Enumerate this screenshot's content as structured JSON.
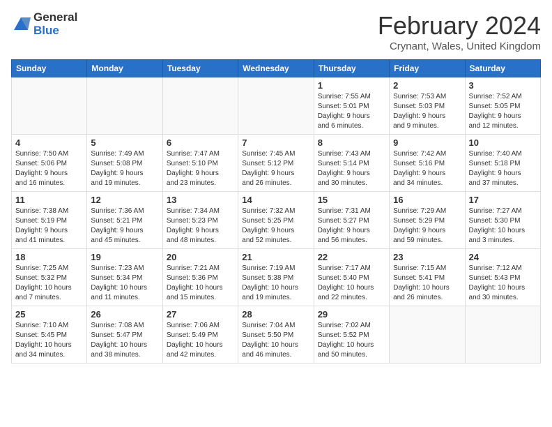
{
  "header": {
    "logo_general": "General",
    "logo_blue": "Blue",
    "month_title": "February 2024",
    "location": "Crynant, Wales, United Kingdom"
  },
  "weekdays": [
    "Sunday",
    "Monday",
    "Tuesday",
    "Wednesday",
    "Thursday",
    "Friday",
    "Saturday"
  ],
  "weeks": [
    [
      {
        "day": "",
        "info": ""
      },
      {
        "day": "",
        "info": ""
      },
      {
        "day": "",
        "info": ""
      },
      {
        "day": "",
        "info": ""
      },
      {
        "day": "1",
        "info": "Sunrise: 7:55 AM\nSunset: 5:01 PM\nDaylight: 9 hours\nand 6 minutes."
      },
      {
        "day": "2",
        "info": "Sunrise: 7:53 AM\nSunset: 5:03 PM\nDaylight: 9 hours\nand 9 minutes."
      },
      {
        "day": "3",
        "info": "Sunrise: 7:52 AM\nSunset: 5:05 PM\nDaylight: 9 hours\nand 12 minutes."
      }
    ],
    [
      {
        "day": "4",
        "info": "Sunrise: 7:50 AM\nSunset: 5:06 PM\nDaylight: 9 hours\nand 16 minutes."
      },
      {
        "day": "5",
        "info": "Sunrise: 7:49 AM\nSunset: 5:08 PM\nDaylight: 9 hours\nand 19 minutes."
      },
      {
        "day": "6",
        "info": "Sunrise: 7:47 AM\nSunset: 5:10 PM\nDaylight: 9 hours\nand 23 minutes."
      },
      {
        "day": "7",
        "info": "Sunrise: 7:45 AM\nSunset: 5:12 PM\nDaylight: 9 hours\nand 26 minutes."
      },
      {
        "day": "8",
        "info": "Sunrise: 7:43 AM\nSunset: 5:14 PM\nDaylight: 9 hours\nand 30 minutes."
      },
      {
        "day": "9",
        "info": "Sunrise: 7:42 AM\nSunset: 5:16 PM\nDaylight: 9 hours\nand 34 minutes."
      },
      {
        "day": "10",
        "info": "Sunrise: 7:40 AM\nSunset: 5:18 PM\nDaylight: 9 hours\nand 37 minutes."
      }
    ],
    [
      {
        "day": "11",
        "info": "Sunrise: 7:38 AM\nSunset: 5:19 PM\nDaylight: 9 hours\nand 41 minutes."
      },
      {
        "day": "12",
        "info": "Sunrise: 7:36 AM\nSunset: 5:21 PM\nDaylight: 9 hours\nand 45 minutes."
      },
      {
        "day": "13",
        "info": "Sunrise: 7:34 AM\nSunset: 5:23 PM\nDaylight: 9 hours\nand 48 minutes."
      },
      {
        "day": "14",
        "info": "Sunrise: 7:32 AM\nSunset: 5:25 PM\nDaylight: 9 hours\nand 52 minutes."
      },
      {
        "day": "15",
        "info": "Sunrise: 7:31 AM\nSunset: 5:27 PM\nDaylight: 9 hours\nand 56 minutes."
      },
      {
        "day": "16",
        "info": "Sunrise: 7:29 AM\nSunset: 5:29 PM\nDaylight: 9 hours\nand 59 minutes."
      },
      {
        "day": "17",
        "info": "Sunrise: 7:27 AM\nSunset: 5:30 PM\nDaylight: 10 hours\nand 3 minutes."
      }
    ],
    [
      {
        "day": "18",
        "info": "Sunrise: 7:25 AM\nSunset: 5:32 PM\nDaylight: 10 hours\nand 7 minutes."
      },
      {
        "day": "19",
        "info": "Sunrise: 7:23 AM\nSunset: 5:34 PM\nDaylight: 10 hours\nand 11 minutes."
      },
      {
        "day": "20",
        "info": "Sunrise: 7:21 AM\nSunset: 5:36 PM\nDaylight: 10 hours\nand 15 minutes."
      },
      {
        "day": "21",
        "info": "Sunrise: 7:19 AM\nSunset: 5:38 PM\nDaylight: 10 hours\nand 19 minutes."
      },
      {
        "day": "22",
        "info": "Sunrise: 7:17 AM\nSunset: 5:40 PM\nDaylight: 10 hours\nand 22 minutes."
      },
      {
        "day": "23",
        "info": "Sunrise: 7:15 AM\nSunset: 5:41 PM\nDaylight: 10 hours\nand 26 minutes."
      },
      {
        "day": "24",
        "info": "Sunrise: 7:12 AM\nSunset: 5:43 PM\nDaylight: 10 hours\nand 30 minutes."
      }
    ],
    [
      {
        "day": "25",
        "info": "Sunrise: 7:10 AM\nSunset: 5:45 PM\nDaylight: 10 hours\nand 34 minutes."
      },
      {
        "day": "26",
        "info": "Sunrise: 7:08 AM\nSunset: 5:47 PM\nDaylight: 10 hours\nand 38 minutes."
      },
      {
        "day": "27",
        "info": "Sunrise: 7:06 AM\nSunset: 5:49 PM\nDaylight: 10 hours\nand 42 minutes."
      },
      {
        "day": "28",
        "info": "Sunrise: 7:04 AM\nSunset: 5:50 PM\nDaylight: 10 hours\nand 46 minutes."
      },
      {
        "day": "29",
        "info": "Sunrise: 7:02 AM\nSunset: 5:52 PM\nDaylight: 10 hours\nand 50 minutes."
      },
      {
        "day": "",
        "info": ""
      },
      {
        "day": "",
        "info": ""
      }
    ]
  ]
}
